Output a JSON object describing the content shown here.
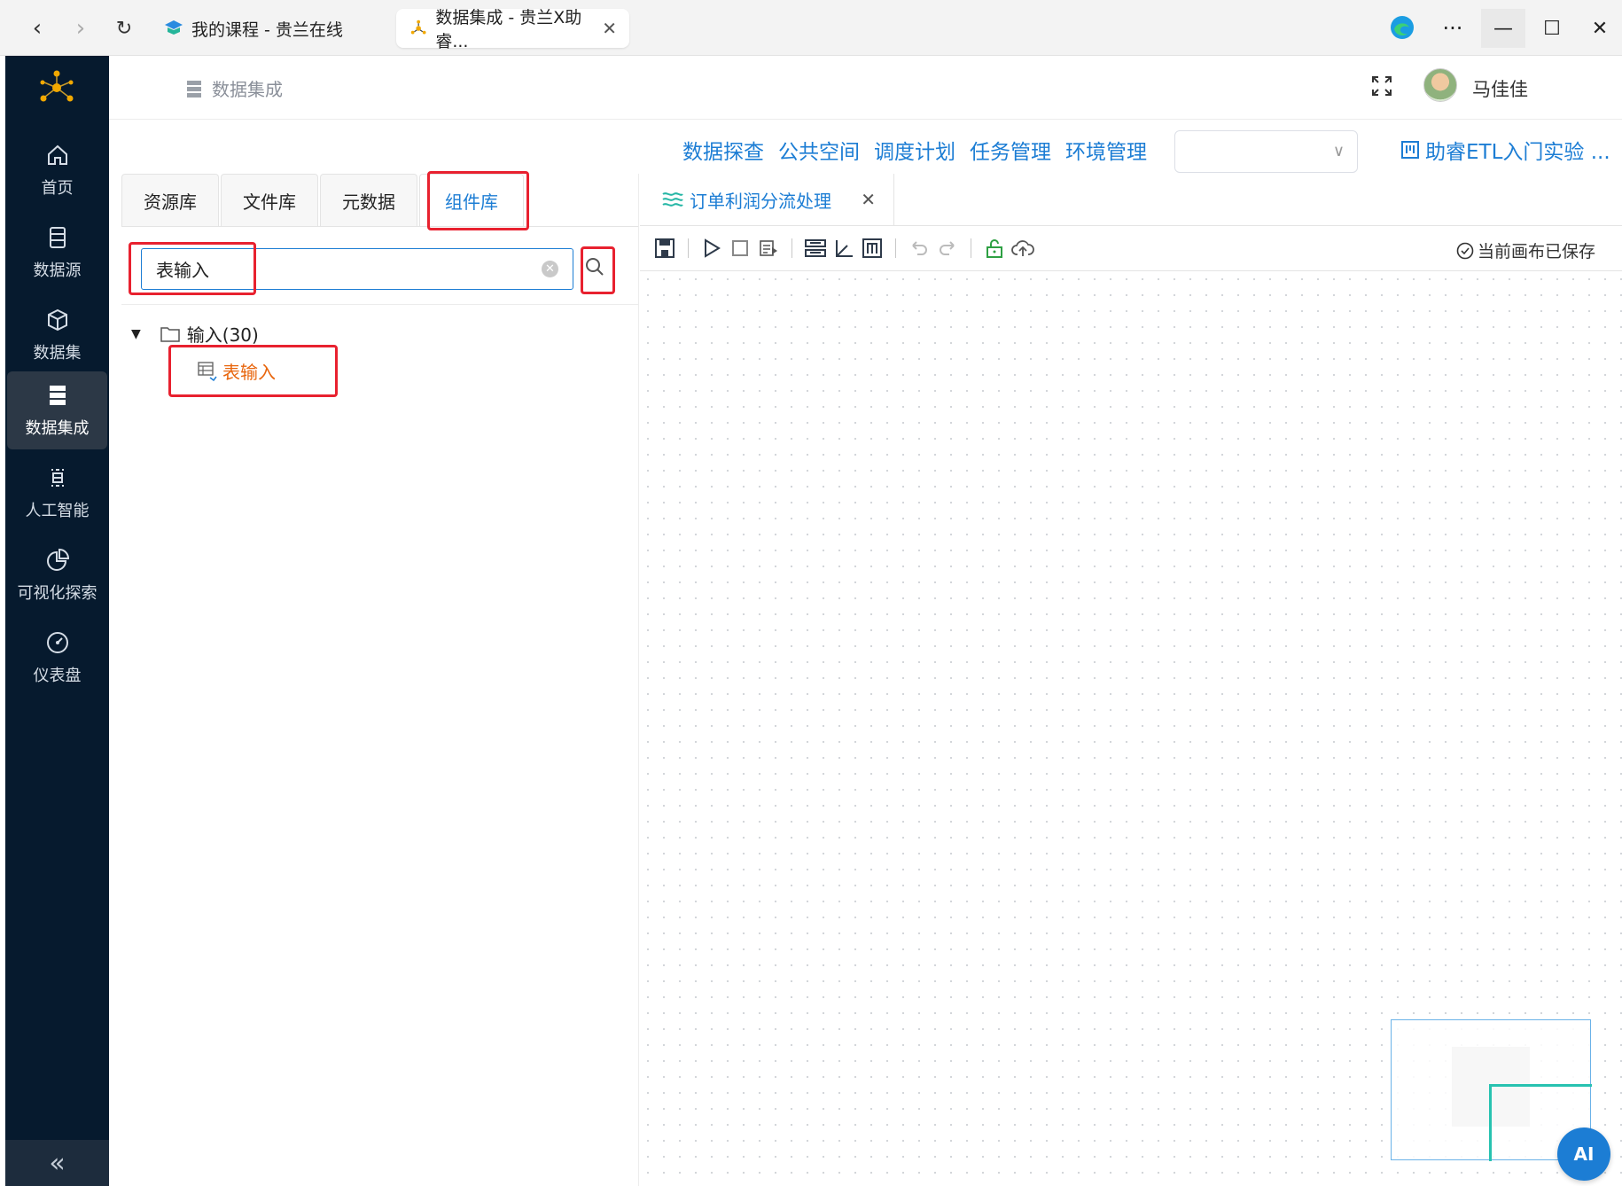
{
  "browser": {
    "tabs": [
      {
        "title": "我的课程 - 贵兰在线",
        "active": false
      },
      {
        "title": "数据集成 - 贵兰X助睿...",
        "active": true
      }
    ]
  },
  "sidenav": {
    "items": [
      {
        "label": "首页",
        "icon": "home-icon"
      },
      {
        "label": "数据源",
        "icon": "database-icon"
      },
      {
        "label": "数据集",
        "icon": "cube-icon"
      },
      {
        "label": "数据集成",
        "icon": "server-icon",
        "active": true
      },
      {
        "label": "人工智能",
        "icon": "ai-icon"
      },
      {
        "label": "可视化探索",
        "icon": "pie-chart-icon"
      },
      {
        "label": "仪表盘",
        "icon": "gauge-icon"
      }
    ],
    "collapse_label": "«"
  },
  "header": {
    "breadcrumb": "数据集成",
    "username": "马佳佳"
  },
  "topmenu": {
    "items": [
      "数据探查",
      "公共空间",
      "调度计划",
      "任务管理",
      "环境管理"
    ],
    "select_value": "",
    "project": "助睿ETL入门实验 ..."
  },
  "library": {
    "tabs": [
      "资源库",
      "文件库",
      "元数据",
      "组件库"
    ],
    "active_tab": "组件库",
    "search_value": "表输入",
    "tree": {
      "folder": "输入(30)",
      "leaf": "表输入"
    }
  },
  "canvas": {
    "tab_title": "订单利润分流处理",
    "saved_status": "当前画布已保存"
  },
  "ai_button": "AI",
  "colors": {
    "accent": "#1c7dd4",
    "sidenav_bg": "#061a2e",
    "highlight": "#e8212f",
    "leaf_text": "#e8660e"
  }
}
